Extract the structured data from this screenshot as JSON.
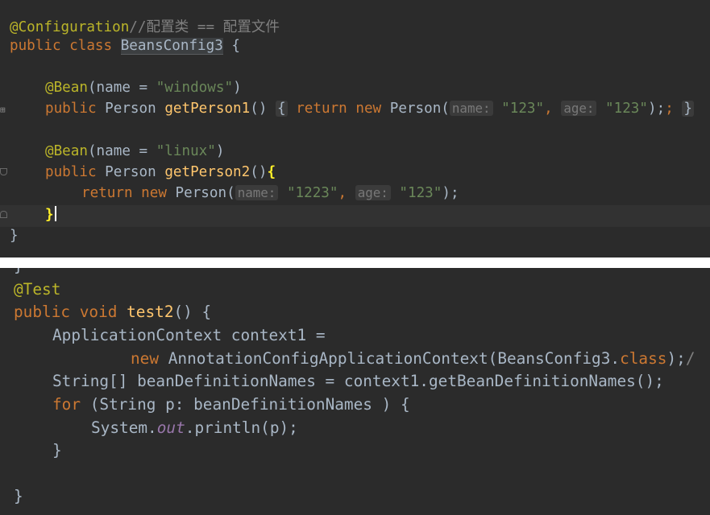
{
  "top_snippet": {
    "line1": {
      "annotation": "@Configuration",
      "comment": "//配置类 == 配置文件"
    },
    "line2": {
      "keyword": "public class",
      "class_name": "BeansConfig3",
      "brace": "{"
    },
    "line4": {
      "annotation": "@Bean",
      "open": "(name = ",
      "value": "\"windows\"",
      "close": ")"
    },
    "line5": {
      "modifier": "public",
      "type": "Person",
      "method": "getPerson1",
      "parens": "()",
      "fold_open": "{",
      "ret": "return",
      "new_kw": "new",
      "ctor": "Person(",
      "hint_name": "name:",
      "arg1": "\"123\"",
      "comma": ",",
      "hint_age": "age:",
      "arg2": "\"123\"",
      "end": ");",
      "semicolon": ";",
      "fold_close": "}"
    },
    "line7": {
      "annotation": "@Bean",
      "open": "(name = ",
      "value": "\"linux\"",
      "close": ")"
    },
    "line8": {
      "modifier": "public",
      "type": "Person",
      "method": "getPerson2",
      "parens": "()",
      "brace": "{"
    },
    "line9": {
      "ret": "return",
      "new_kw": "new",
      "ctor": "Person(",
      "hint_name": "name:",
      "arg1": "\"1223\"",
      "comma": ",",
      "hint_age": "age:",
      "arg2": "\"123\"",
      "end": ");"
    },
    "line10": {
      "brace": "}"
    },
    "line11": {
      "brace": "}"
    }
  },
  "bottom_snippet": {
    "line0": {
      "brace": "}"
    },
    "line1": {
      "annotation": "@Test"
    },
    "line2": {
      "modifier": "public",
      "void_kw": "void",
      "method": "test2",
      "rest": "() {"
    },
    "line3": {
      "text": "ApplicationContext context1 ="
    },
    "line4": {
      "new_kw": "new",
      "ctor": "AnnotationConfigApplicationContext(BeansConfig3.",
      "class_kw": "class",
      "end": ");",
      "trail": "/"
    },
    "line5": {
      "text": "String[] beanDefinitionNames = context1.getBeanDefinitionNames();"
    },
    "line6": {
      "for_kw": "for",
      "rest": "(String p: beanDefinitionNames ) {"
    },
    "line7": {
      "obj": "System.",
      "field": "out",
      "call": ".println(p);"
    },
    "line8": {
      "brace": "}"
    },
    "line10": {
      "brace": "}"
    }
  },
  "colors": {
    "background": "#2b2b2b",
    "annotation": "#bbb529",
    "keyword": "#cc7832",
    "string": "#6a8759",
    "comment": "#808080",
    "method": "#ffc66d",
    "static_field": "#9876aa",
    "default_text": "#a9b7c6"
  }
}
